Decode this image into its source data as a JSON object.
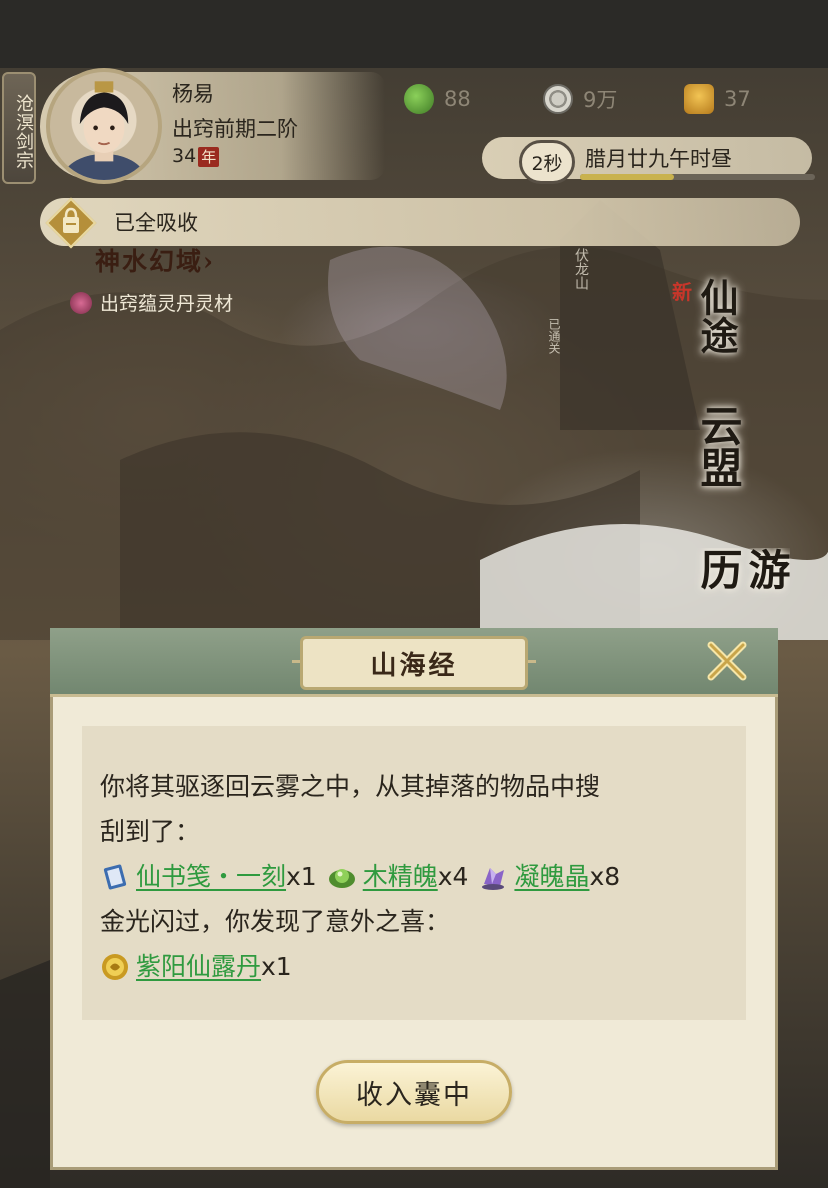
{
  "header": {
    "sect": "沧溟剑宗",
    "player": {
      "name": "杨易",
      "realm": "出窍前期二阶",
      "age": "34",
      "age_unit": "年"
    },
    "resources": [
      {
        "icon": "jade-leaf-icon",
        "value": "88",
        "color": "#5c9a3a"
      },
      {
        "icon": "coin-icon",
        "value": "9万",
        "color": "#b8b6ad"
      },
      {
        "icon": "strength-icon",
        "value": "37",
        "color": "#d6a02c"
      }
    ],
    "timer": {
      "countdown": "2秒",
      "date": "腊月廿九午时昼",
      "progress": 0.4
    },
    "absorb_text": "已全吸收",
    "area_title": "神水幻域",
    "area_arrow": "›",
    "quest": "出窍蕴灵丹灵材"
  },
  "map": {
    "labels": [
      "伏龙山",
      "已通关"
    ],
    "side_buttons": [
      "仙途",
      "云盟",
      "游历"
    ],
    "new_tag": "新"
  },
  "dialog": {
    "title": "山海经",
    "lines": {
      "line1": "你将其驱逐回云雾之中，从其掉落的物品中搜",
      "line2": "刮到了：",
      "line4": "金光闪过，你发现了意外之喜："
    },
    "drops": [
      {
        "name": "仙书笺・一刻",
        "qty": "x1",
        "icon": "scroll-book-icon"
      },
      {
        "name": "木精魄",
        "qty": "x4",
        "icon": "green-orb-icon"
      },
      {
        "name": "凝魄晶",
        "qty": "x8",
        "icon": "purple-crystal-icon"
      }
    ],
    "bonus": [
      {
        "name": "紫阳仙露丹",
        "qty": "x1",
        "icon": "gold-pill-icon"
      }
    ],
    "confirm_label": "收入囊中"
  }
}
